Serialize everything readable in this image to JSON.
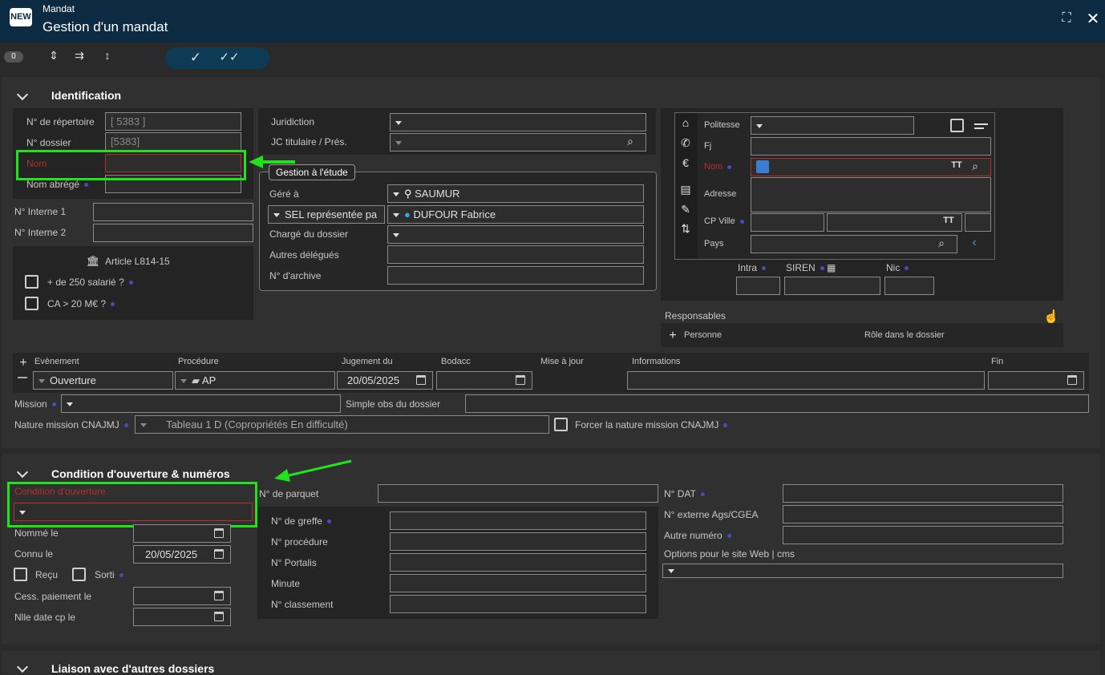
{
  "app": {
    "logo": "NEW",
    "name": "Mandat",
    "title": "Gestion d'un mandat"
  },
  "toolbar": {
    "attach_count": "0"
  },
  "identification": {
    "title": "Identification",
    "repertoire_label": "N° de répertoire",
    "repertoire_value": "[ 5383 ]",
    "dossier_label": "N° dossier",
    "dossier_value": "[5383]",
    "nom_label": "Nom",
    "nom_abrege_label": "Nom abrégé",
    "interne1_label": "N° Interne 1",
    "interne2_label": "N° Interne 2",
    "article_title": "Article L814-15",
    "plus250_label": "+ de 250 salarié ?",
    "ca20_label": "CA > 20 M€ ?",
    "juridiction_label": "Juridiction",
    "jc_label": "JC titulaire / Prés.",
    "gestion_title": "Gestion à l'étude",
    "gere_label": "Géré à",
    "gere_value": "SAUMUR",
    "sel_value": "SEL représentée pa",
    "sel_person": "DUFOUR Fabrice",
    "charge_label": "Chargé du dossier",
    "autres_label": "Autres délégués",
    "archive_label": "N° d'archive",
    "politesse_label": "Politesse",
    "fj_label": "Fj",
    "contact_nom_label": "Nom",
    "adresse_label": "Adresse",
    "cpville_label": "CP Ville",
    "pays_label": "Pays",
    "intra_label": "Intra",
    "siren_label": "SIREN",
    "nic_label": "Nic",
    "responsables_label": "Responsables",
    "personne_label": "Personne",
    "role_label": "Rôle dans le dossier"
  },
  "events": {
    "headers": [
      "Evènement",
      "Procédure",
      "Jugement du",
      "Bodacc",
      "Mise à jour",
      "Informations",
      "Fin"
    ],
    "row": {
      "evenement": "Ouverture",
      "procedure": "AP",
      "jugement": "20/05/2025"
    },
    "mission_label": "Mission",
    "simple_obs_label": "Simple obs du dossier",
    "nature_label": "Nature mission CNAJMJ",
    "nature_value": "Tableau 1 D (Copropriétés En difficulté)",
    "forcer_label": "Forcer la nature mission CNAJMJ"
  },
  "condition": {
    "title": "Condition d'ouverture & numéros",
    "condition_label": "Condition d'ouverture",
    "nomme_label": "Nommé le",
    "connu_label": "Connu le",
    "connu_value": "20/05/2025",
    "recu_label": "Reçu",
    "sorti_label": "Sorti",
    "cess_label": "Cess. paiement le",
    "nlle_label": "Nlle date cp le",
    "parquet_label": "N° de parquet",
    "greffe_label": "N° de greffe",
    "procedure_label": "N° procédure",
    "portalis_label": "N° Portalis",
    "minute_label": "Minute",
    "classement_label": "N° classement",
    "dat_label": "N° DAT",
    "externe_label": "N° externe Ags/CGEA",
    "autre_label": "Autre numéro",
    "options_label": "Options pour le site Web | cms"
  },
  "liaison": {
    "title": "Liaison avec d'autres dossiers"
  }
}
